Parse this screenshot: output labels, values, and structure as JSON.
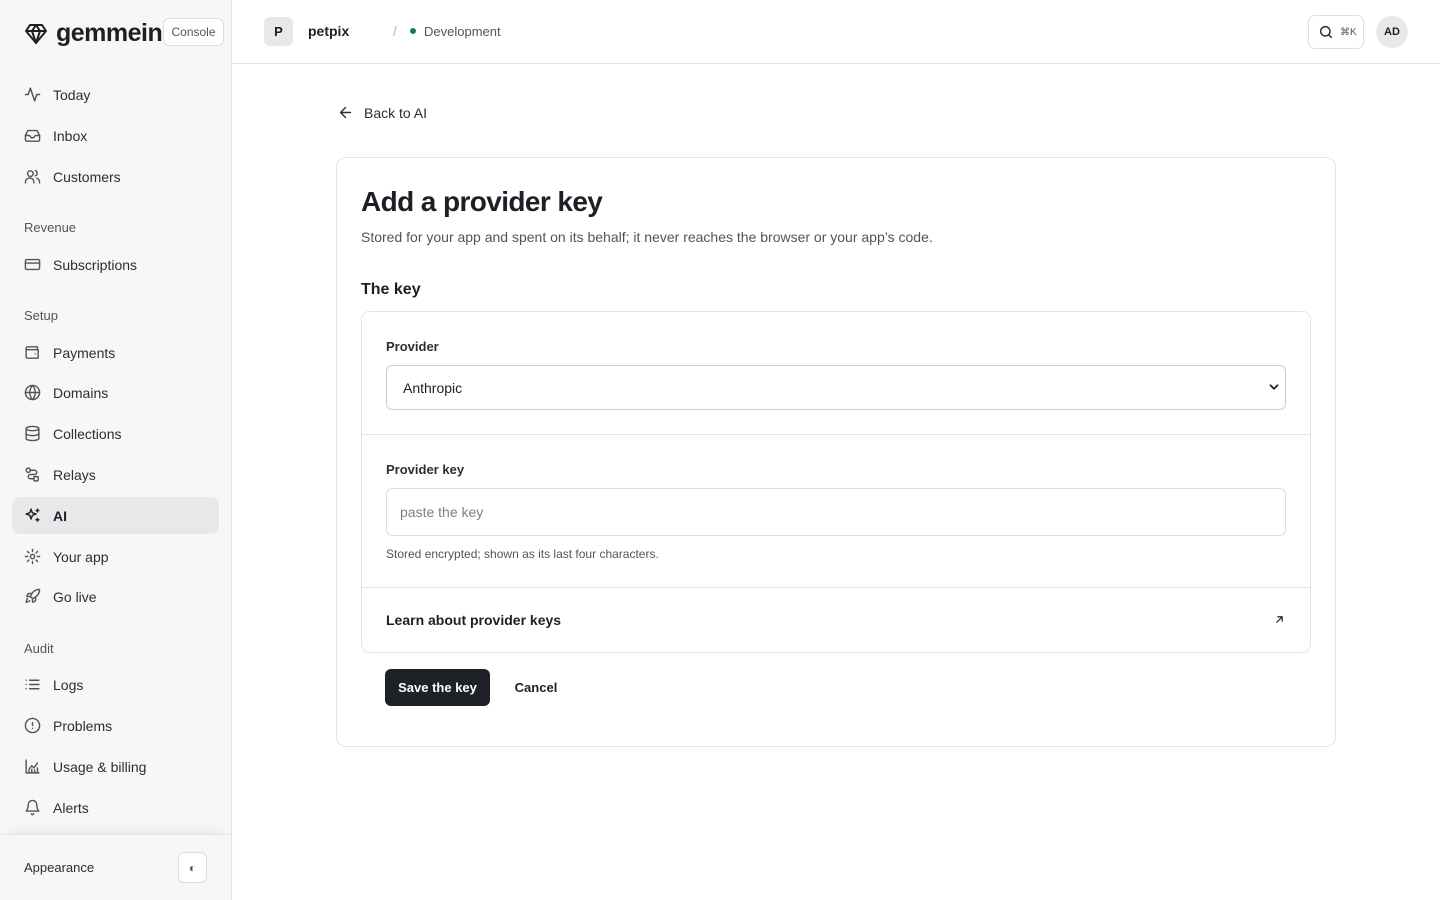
{
  "brand": {
    "name": "gemmein",
    "badge": "Console",
    "logo_icon": "gem-icon"
  },
  "sidebar": {
    "primary": [
      {
        "label": "Today",
        "icon": "activity-icon"
      },
      {
        "label": "Inbox",
        "icon": "inbox-icon"
      },
      {
        "label": "Customers",
        "icon": "users-icon"
      }
    ],
    "revenue": {
      "label": "Revenue",
      "items": [
        {
          "label": "Subscriptions",
          "icon": "credit-card-icon"
        }
      ]
    },
    "setup": {
      "label": "Setup",
      "items": [
        {
          "label": "Payments",
          "icon": "wallet-icon"
        },
        {
          "label": "Domains",
          "icon": "globe-icon"
        },
        {
          "label": "Collections",
          "icon": "database-icon"
        },
        {
          "label": "Relays",
          "icon": "route-icon"
        },
        {
          "label": "AI",
          "icon": "sparkles-icon",
          "active": true
        },
        {
          "label": "Your app",
          "icon": "gear-icon"
        },
        {
          "label": "Go live",
          "icon": "rocket-icon"
        }
      ]
    },
    "audit": {
      "label": "Audit",
      "items": [
        {
          "label": "Logs",
          "icon": "list-icon"
        },
        {
          "label": "Problems",
          "icon": "alert-circle-icon"
        },
        {
          "label": "Usage & billing",
          "icon": "chart-icon"
        },
        {
          "label": "Alerts",
          "icon": "bell-icon"
        }
      ]
    },
    "footer": {
      "appearance_label": "Appearance",
      "toggle_icon": "contrast-icon",
      "toggle_glyph": "◐"
    }
  },
  "topbar": {
    "project_initial": "P",
    "project_name": "petpix",
    "separator": "/",
    "environment": "Development",
    "environment_color": "#1f7a4d",
    "search_shortcut": "⌘K",
    "user_initials": "AD"
  },
  "main": {
    "back_label": "Back to AI",
    "title": "Add a provider key",
    "subtitle": "Stored for your app and spent on its behalf; it never reaches the browser or your app’s code.",
    "section_title": "The key",
    "provider": {
      "label": "Provider",
      "value": "Anthropic"
    },
    "provider_key": {
      "label": "Provider key",
      "placeholder": "paste the key",
      "value": "",
      "help": "Stored encrypted; shown as its last four characters."
    },
    "learn_link": "Learn about provider keys",
    "save_label": "Save the key",
    "cancel_label": "Cancel"
  },
  "colors": {
    "primary_button": "#1e2228",
    "active_nav_bg": "#e7e8ea",
    "sidebar_bg": "#f7f7f8"
  }
}
